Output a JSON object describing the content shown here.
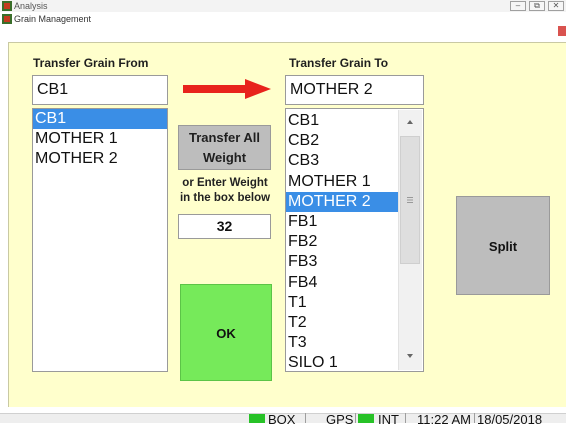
{
  "outer_window": {
    "title": "Analysis",
    "controls": [
      "–",
      "⧉",
      "✕"
    ]
  },
  "inner_window": {
    "title": "Grain Management"
  },
  "from": {
    "label": "Transfer Grain From",
    "value": "CB1",
    "items": [
      "CB1",
      "MOTHER 1",
      "MOTHER 2"
    ],
    "selected_index": 0
  },
  "to": {
    "label": "Transfer Grain To",
    "value": "MOTHER 2",
    "items": [
      "CB1",
      "CB2",
      "CB3",
      "MOTHER 1",
      "MOTHER 2",
      "FB1",
      "FB2",
      "FB3",
      "FB4",
      "T1",
      "T2",
      "T3",
      "SILO 1"
    ],
    "selected_index": 4
  },
  "transfer_all": {
    "line1": "Transfer All",
    "line2": "Weight"
  },
  "weight": {
    "hint_line1": "or Enter Weight",
    "hint_line2": "in the box below",
    "value": "32"
  },
  "ok_label": "OK",
  "split_label": "Split",
  "status": {
    "box": "BOX",
    "gps": "GPS",
    "int": "INT",
    "time": "11:22 AM",
    "date": "18/05/2018"
  },
  "colors": {
    "panel_bg": "#ffffcc",
    "selection": "#3a8ee6",
    "ok_button": "#76ea5a",
    "arrow": "#e8231c",
    "status_ok": "#27c227"
  },
  "icons": {
    "arrow": "right-arrow-icon",
    "scroll_up": "chevron-up-icon",
    "scroll_down": "chevron-down-icon",
    "scroll_grip": "grip-icon"
  }
}
